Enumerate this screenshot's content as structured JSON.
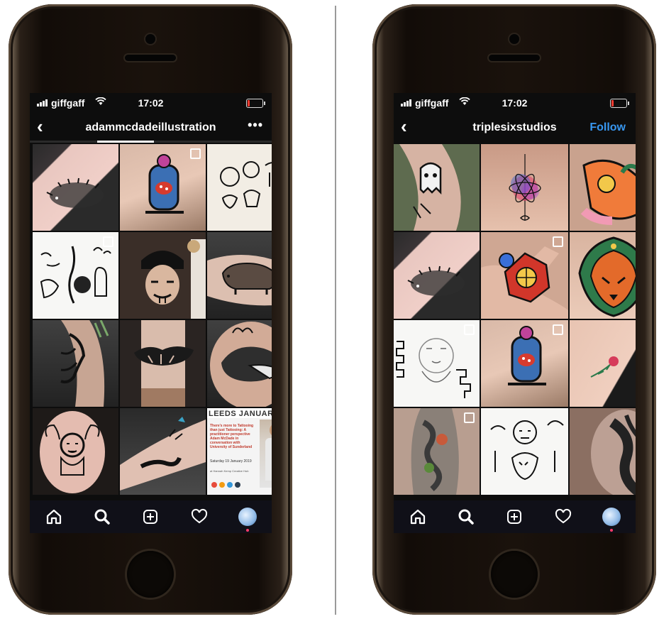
{
  "phones": [
    {
      "status": {
        "carrier": "giffgaff",
        "time": "17:02"
      },
      "header": {
        "back": "‹",
        "title": "adammcdadeillustration",
        "more": "•••",
        "follow": ""
      },
      "leaflet": {
        "heading": "LEEDS JANUARY",
        "body": "There's more to Tattooing than just Tattooing: A practitioner perspective Adam McDade in conversation with University of Sunderland",
        "date": "Saturday 19 January 2019",
        "venue": "at Hannah Kemp Creative Hub"
      },
      "tabbar": [
        "home-icon",
        "search-icon",
        "add-post-icon",
        "heart-icon",
        "profile-avatar"
      ]
    },
    {
      "status": {
        "carrier": "giffgaff",
        "time": "17:02"
      },
      "header": {
        "back": "‹",
        "title": "triplesixstudios",
        "more": "",
        "follow": "Follow"
      },
      "tabbar": [
        "home-icon",
        "search-icon",
        "add-post-icon",
        "heart-icon",
        "profile-avatar"
      ]
    }
  ],
  "colors": {
    "follow": "#3897f0",
    "screen": "#0d0d0d",
    "battery_low": "#ff3b30"
  }
}
